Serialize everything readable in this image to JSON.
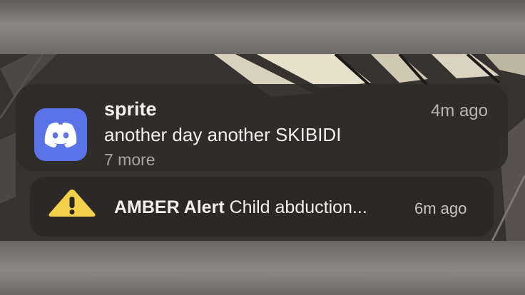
{
  "notification": {
    "app_name": "sprite",
    "time": "4m ago",
    "message": "another day another SKIBIDI",
    "more_count": "7 more",
    "icon": "discord-icon",
    "icon_color": "#5B73E8"
  },
  "alert": {
    "app_name": "AMBER Alert",
    "message": "Child abduction...",
    "time": "6m ago",
    "icon": "warning-icon",
    "icon_color": "#F2D04A"
  }
}
